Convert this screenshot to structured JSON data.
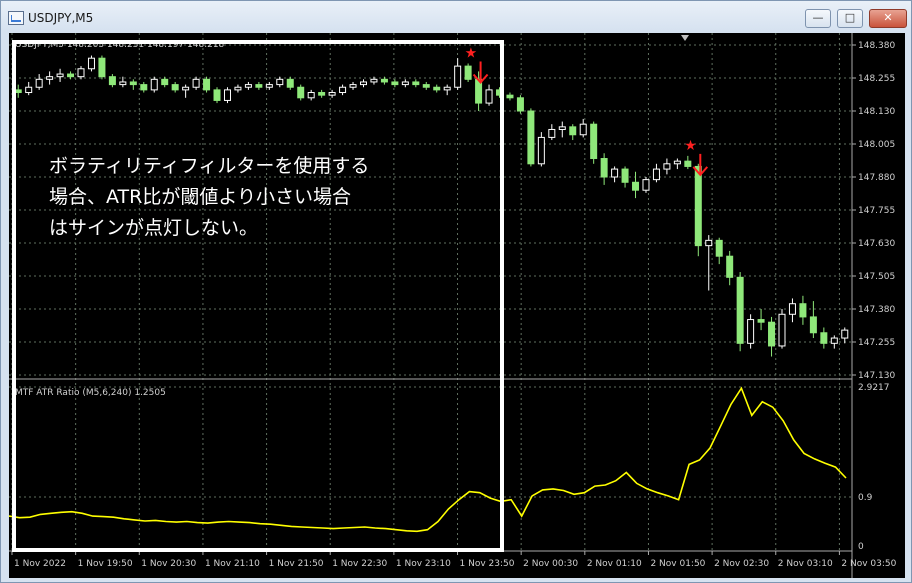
{
  "window": {
    "title": "USDJPY,M5",
    "min_glyph": "—",
    "max_glyph": "□",
    "close_glyph": "✕",
    "icon": "chart-window-icon"
  },
  "annotation": {
    "text": "ボラティリティフィルターを使用する\n場合、ATR比が閾値より小さい場合\nはサインが点灯しない。",
    "box_color": "#ffffff"
  },
  "price_panel": {
    "header": "USDJPY,M5 148.203 148.231 148.197 148.218",
    "price_labels": [
      "148.380",
      "148.255",
      "148.130",
      "148.005",
      "147.880",
      "147.755",
      "147.630",
      "147.505",
      "147.380",
      "147.255",
      "147.130"
    ]
  },
  "indicator_panel": {
    "header": "MTF ATR Ratio  (M5,6,240) 1.2505",
    "scale_labels": [
      "2.9217",
      "0.9",
      "0"
    ],
    "line_color": "#ffff00"
  },
  "time_axis": {
    "labels": [
      "1 Nov 2022",
      "1 Nov 19:50",
      "1 Nov 20:30",
      "1 Nov 21:10",
      "1 Nov 21:50",
      "1 Nov 22:30",
      "1 Nov 23:10",
      "1 Nov 23:50",
      "2 Nov 00:30",
      "2 Nov 01:10",
      "2 Nov 01:50",
      "2 Nov 02:30",
      "2 Nov 03:10",
      "2 Nov 03:50"
    ]
  },
  "colors": {
    "background": "#000000",
    "grid": "#5f6f5f",
    "bull_candle": "#ffffff",
    "bear_candle": "#8fe87a",
    "signal": "#ff2020"
  },
  "chart_data": {
    "type": "candlestick",
    "y_range": [
      147.13,
      148.38
    ],
    "candles": [
      [
        148.21,
        148.23,
        148.18,
        148.2
      ],
      [
        148.2,
        148.24,
        148.19,
        148.22
      ],
      [
        148.22,
        148.27,
        148.21,
        148.25
      ],
      [
        148.25,
        148.28,
        148.23,
        148.26
      ],
      [
        148.26,
        148.29,
        148.24,
        148.27
      ],
      [
        148.27,
        148.28,
        148.25,
        148.26
      ],
      [
        148.26,
        148.3,
        148.25,
        148.29
      ],
      [
        148.29,
        148.34,
        148.28,
        148.33
      ],
      [
        148.33,
        148.34,
        148.25,
        148.26
      ],
      [
        148.26,
        148.27,
        148.22,
        148.23
      ],
      [
        148.23,
        148.26,
        148.22,
        148.24
      ],
      [
        148.24,
        148.25,
        148.21,
        148.23
      ],
      [
        148.23,
        148.24,
        148.2,
        148.21
      ],
      [
        148.21,
        148.26,
        148.2,
        148.25
      ],
      [
        148.25,
        148.26,
        148.22,
        148.23
      ],
      [
        148.23,
        148.24,
        148.2,
        148.21
      ],
      [
        148.21,
        148.23,
        148.18,
        148.22
      ],
      [
        148.22,
        148.26,
        148.21,
        148.25
      ],
      [
        148.25,
        148.26,
        148.2,
        148.21
      ],
      [
        148.21,
        148.22,
        148.16,
        148.17
      ],
      [
        148.17,
        148.22,
        148.16,
        148.21
      ],
      [
        148.21,
        148.23,
        148.2,
        148.22
      ],
      [
        148.22,
        148.24,
        148.21,
        148.23
      ],
      [
        148.23,
        148.24,
        148.21,
        148.22
      ],
      [
        148.22,
        148.24,
        148.21,
        148.23
      ],
      [
        148.23,
        148.26,
        148.22,
        148.25
      ],
      [
        148.25,
        148.26,
        148.21,
        148.22
      ],
      [
        148.22,
        148.23,
        148.17,
        148.18
      ],
      [
        148.18,
        148.21,
        148.17,
        148.2
      ],
      [
        148.2,
        148.21,
        148.18,
        148.19
      ],
      [
        148.19,
        148.21,
        148.18,
        148.2
      ],
      [
        148.2,
        148.23,
        148.19,
        148.22
      ],
      [
        148.22,
        148.24,
        148.21,
        148.23
      ],
      [
        148.23,
        148.25,
        148.22,
        148.24
      ],
      [
        148.24,
        148.26,
        148.23,
        148.25
      ],
      [
        148.25,
        148.26,
        148.23,
        148.24
      ],
      [
        148.24,
        148.25,
        148.22,
        148.23
      ],
      [
        148.23,
        148.25,
        148.22,
        148.24
      ],
      [
        148.24,
        148.25,
        148.22,
        148.23
      ],
      [
        148.23,
        148.24,
        148.21,
        148.22
      ],
      [
        148.22,
        148.23,
        148.2,
        148.21
      ],
      [
        148.21,
        148.23,
        148.19,
        148.22
      ],
      [
        148.22,
        148.33,
        148.21,
        148.3
      ],
      [
        148.3,
        148.31,
        148.24,
        148.25
      ],
      [
        148.25,
        148.28,
        148.13,
        148.16
      ],
      [
        148.16,
        148.23,
        148.15,
        148.21
      ],
      [
        148.21,
        148.22,
        148.18,
        148.19
      ],
      [
        148.19,
        148.2,
        148.17,
        148.18
      ],
      [
        148.18,
        148.19,
        148.12,
        148.13
      ],
      [
        148.13,
        148.14,
        147.92,
        147.93
      ],
      [
        147.93,
        148.05,
        147.92,
        148.03
      ],
      [
        148.03,
        148.08,
        148.02,
        148.06
      ],
      [
        148.06,
        148.09,
        148.03,
        148.07
      ],
      [
        148.07,
        148.08,
        148.02,
        148.04
      ],
      [
        148.04,
        148.1,
        148.03,
        148.08
      ],
      [
        148.08,
        148.09,
        147.93,
        147.95
      ],
      [
        147.95,
        147.97,
        147.85,
        147.88
      ],
      [
        147.88,
        147.92,
        147.86,
        147.91
      ],
      [
        147.91,
        147.92,
        147.84,
        147.86
      ],
      [
        147.86,
        147.9,
        147.8,
        147.83
      ],
      [
        147.83,
        147.88,
        147.82,
        147.87
      ],
      [
        147.87,
        147.93,
        147.86,
        147.91
      ],
      [
        147.91,
        147.95,
        147.89,
        147.93
      ],
      [
        147.93,
        147.95,
        147.91,
        147.94
      ],
      [
        147.94,
        147.96,
        147.91,
        147.92
      ],
      [
        147.92,
        147.93,
        147.58,
        147.62
      ],
      [
        147.62,
        147.66,
        147.45,
        147.64
      ],
      [
        147.64,
        147.65,
        147.55,
        147.58
      ],
      [
        147.58,
        147.6,
        147.47,
        147.5
      ],
      [
        147.5,
        147.52,
        147.22,
        147.25
      ],
      [
        147.25,
        147.36,
        147.23,
        147.34
      ],
      [
        147.34,
        147.38,
        147.3,
        147.33
      ],
      [
        147.33,
        147.35,
        147.2,
        147.24
      ],
      [
        147.24,
        147.38,
        147.23,
        147.36
      ],
      [
        147.36,
        147.42,
        147.33,
        147.4
      ],
      [
        147.4,
        147.43,
        147.32,
        147.35
      ],
      [
        147.35,
        147.41,
        147.27,
        147.29
      ],
      [
        147.29,
        147.31,
        147.23,
        147.25
      ],
      [
        147.25,
        147.28,
        147.23,
        147.27
      ],
      [
        147.27,
        147.31,
        147.25,
        147.3
      ]
    ],
    "signals": [
      {
        "index": 44,
        "price": 148.31,
        "type": "sell"
      },
      {
        "index": 65,
        "price": 147.96,
        "type": "sell"
      }
    ],
    "atr_ratio": {
      "name": "MTF ATR Ratio",
      "y_range": [
        0,
        2.9217
      ],
      "values": [
        0.55,
        0.52,
        0.53,
        0.58,
        0.6,
        0.62,
        0.63,
        0.6,
        0.55,
        0.54,
        0.53,
        0.5,
        0.48,
        0.46,
        0.47,
        0.45,
        0.44,
        0.45,
        0.43,
        0.42,
        0.44,
        0.45,
        0.44,
        0.43,
        0.41,
        0.4,
        0.38,
        0.36,
        0.35,
        0.34,
        0.33,
        0.32,
        0.33,
        0.34,
        0.35,
        0.33,
        0.32,
        0.3,
        0.28,
        0.27,
        0.3,
        0.45,
        0.68,
        0.85,
        1.0,
        0.98,
        0.88,
        0.82,
        0.85,
        0.55,
        0.92,
        1.03,
        1.05,
        1.02,
        0.95,
        0.98,
        1.1,
        1.12,
        1.2,
        1.35,
        1.15,
        1.05,
        0.98,
        0.92,
        0.85,
        1.5,
        1.58,
        1.8,
        2.2,
        2.6,
        2.9,
        2.4,
        2.65,
        2.55,
        2.3,
        1.95,
        1.7,
        1.6,
        1.52,
        1.45,
        1.25
      ]
    }
  }
}
